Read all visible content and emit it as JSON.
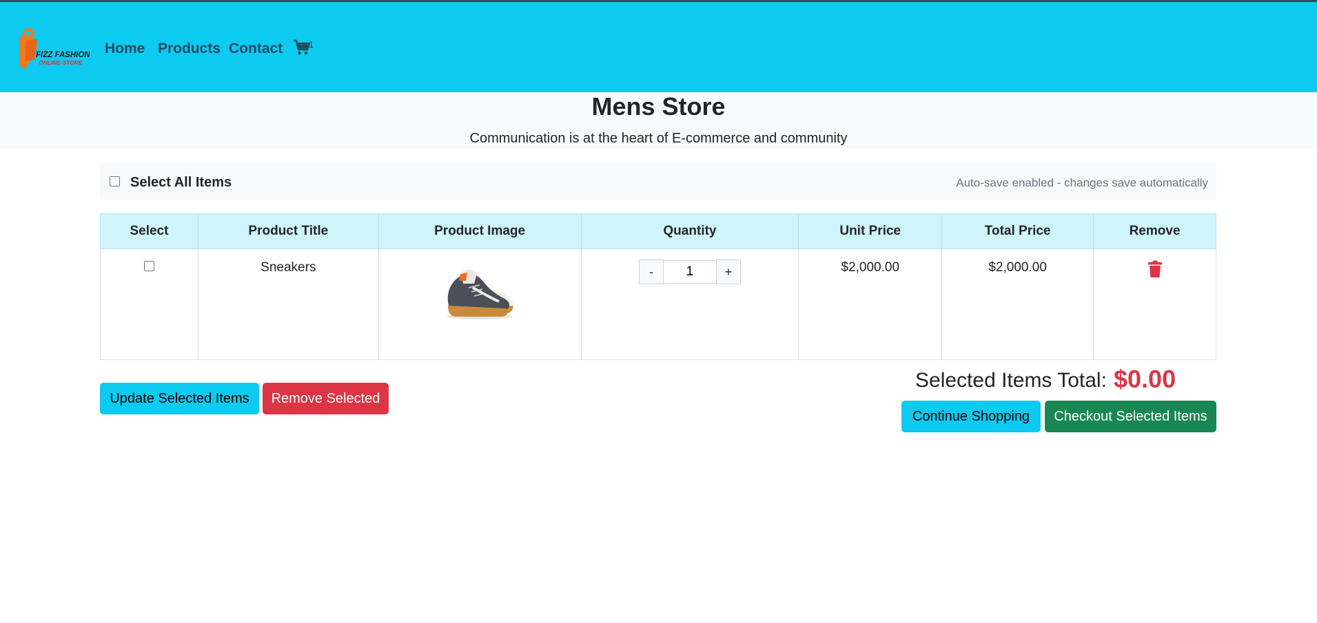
{
  "colors": {
    "navbar_bg": "#0dcaf0",
    "nav_text": "#1f4b5f",
    "hero_bg": "#f8f9fa",
    "table_header_bg": "#cff4fc",
    "danger": "#dc3545",
    "success": "#198754",
    "info": "#0dcaf0"
  },
  "brand": {
    "logo_line1": "FIZZ FASHION",
    "logo_line2": "ONLINE STORE",
    "logo_icon": "shopping-bag-logo"
  },
  "nav": {
    "links": [
      "Home",
      "Products",
      "Contact"
    ],
    "cart_icon": "shopping-cart-icon",
    "cart_count": "1"
  },
  "hero": {
    "title": "Mens Store",
    "subtitle": "Communication is at the heart of E-commerce and community"
  },
  "select_bar": {
    "select_all_label": "Select All Items",
    "autosave_text": "Auto-save enabled - changes save automatically"
  },
  "table": {
    "headers": [
      "Select",
      "Product Title",
      "Product Image",
      "Quantity",
      "Unit Price",
      "Total Price",
      "Remove"
    ],
    "rows": [
      {
        "selected": false,
        "title": "Sneakers",
        "image": "sneaker-product-image",
        "quantity": "1",
        "minus_label": "-",
        "plus_label": "+",
        "unit_price": "$2,000.00",
        "total_price": "$2,000.00",
        "remove_icon": "trash-icon"
      }
    ]
  },
  "actions": {
    "update_label": "Update Selected Items",
    "remove_selected_label": "Remove Selected",
    "continue_label": "Continue Shopping",
    "checkout_label": "Checkout Selected Items"
  },
  "summary": {
    "total_label": "Selected Items Total:",
    "total_value": "$0.00"
  }
}
